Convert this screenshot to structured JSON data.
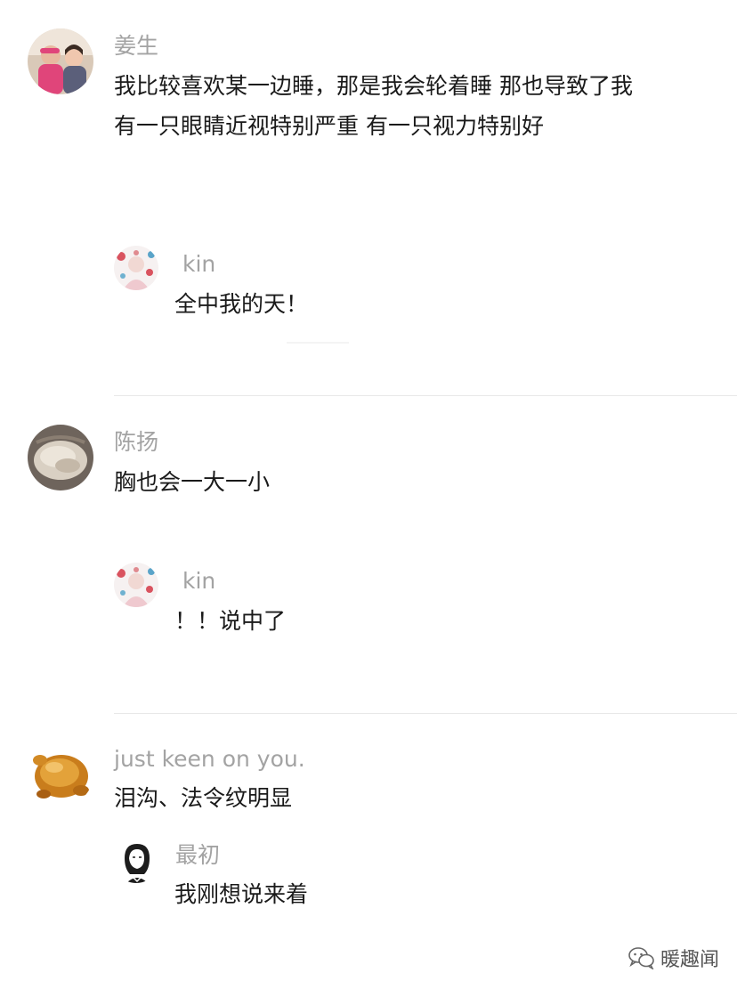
{
  "comments": [
    {
      "author": "姜生",
      "text": "我比较喜欢某一边睡，那是我会轮着睡 那也导致了我有一只眼睛近视特别严重 有一只视力特别好",
      "reply": {
        "author": "kin",
        "text": "全中我的天！"
      }
    },
    {
      "author": "陈扬",
      "text": "胸也会一大一小",
      "reply": {
        "author": "kin",
        "text": "！！说中了"
      }
    },
    {
      "author": "just keen on you.",
      "text": "泪沟、法令纹明显",
      "reply": {
        "author": "最初",
        "text": "我刚想说来着"
      }
    }
  ],
  "watermark": {
    "text": "暖趣闻",
    "icon": "wechat-icon"
  }
}
